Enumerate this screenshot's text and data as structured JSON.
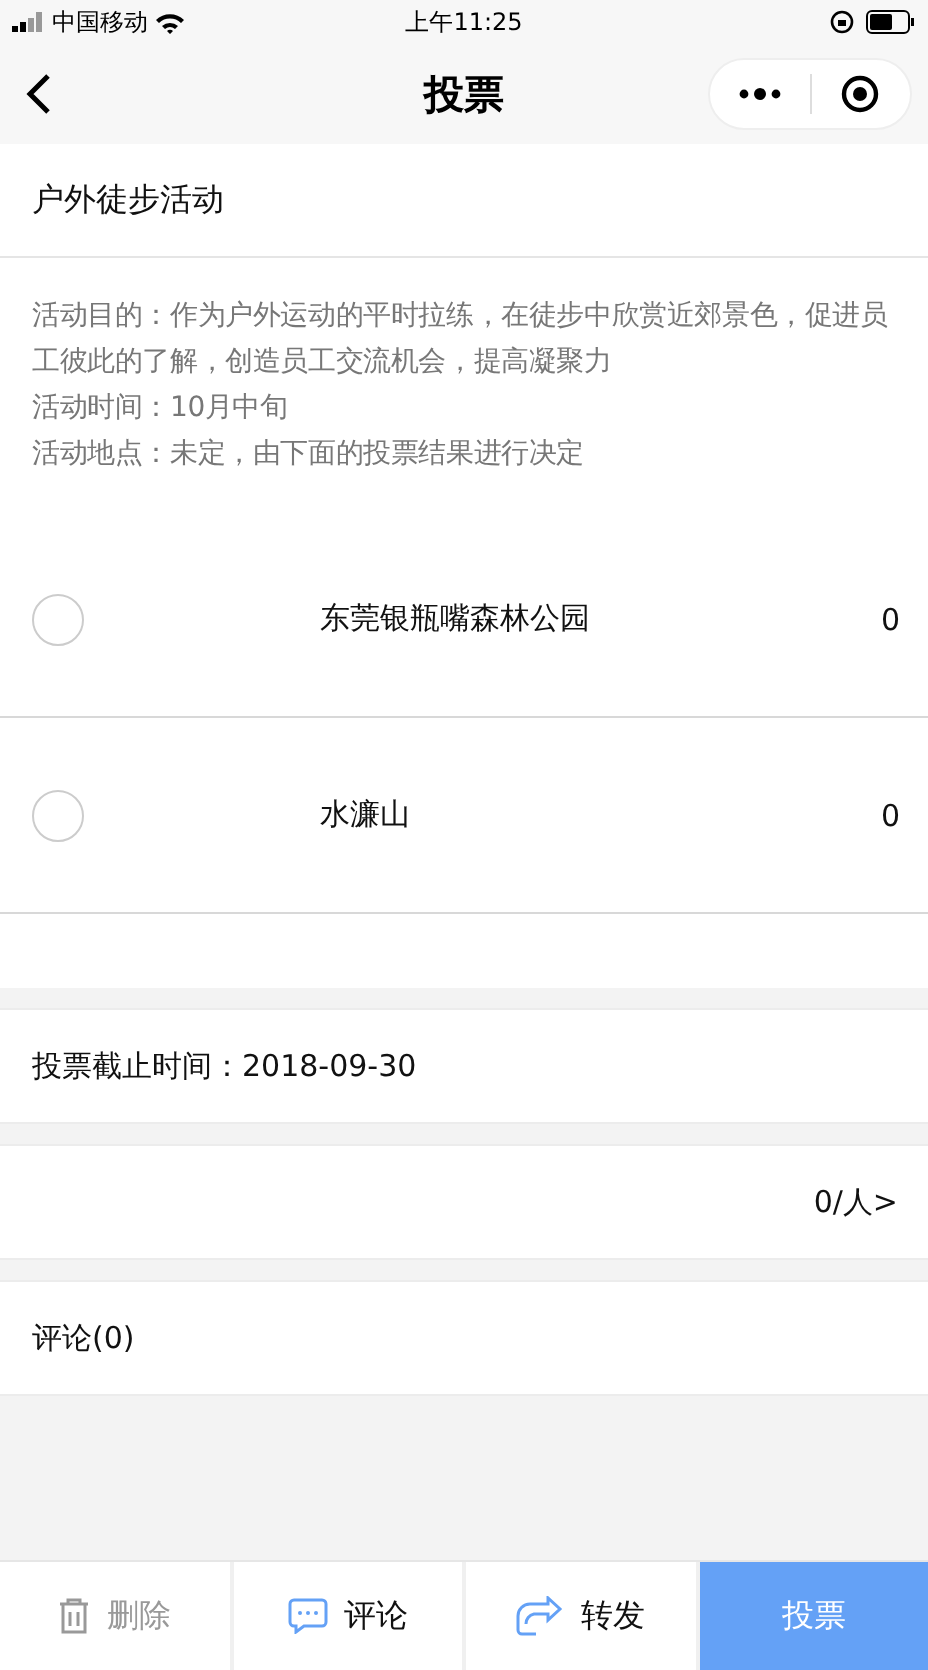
{
  "status_bar": {
    "carrier": "中国移动",
    "time": "上午11:25"
  },
  "nav": {
    "title": "投票"
  },
  "activity": {
    "title": "户外徒步活动",
    "description": [
      "活动目的：作为户外运动的平时拉练，在徒步中欣赏近郊景色，促进员工彼此的了解，创造员工交流机会，提高凝聚力",
      "活动时间：10月中旬",
      "活动地点：未定，由下面的投票结果进行决定"
    ]
  },
  "options": [
    {
      "label": "东莞银瓶嘴森林公园",
      "votes": "0",
      "selected": false
    },
    {
      "label": "水濂山",
      "votes": "0",
      "selected": false
    }
  ],
  "deadline": "投票截止时间：2018-09-30",
  "voters": "0/人>",
  "comments": "评论(0)",
  "toolbar": [
    {
      "kind": "delete",
      "label": "删除",
      "disabled": true
    },
    {
      "kind": "comment",
      "label": "评论",
      "disabled": false
    },
    {
      "kind": "share",
      "label": "转发",
      "disabled": false
    },
    {
      "kind": "vote",
      "label": "投票",
      "disabled": false
    }
  ]
}
